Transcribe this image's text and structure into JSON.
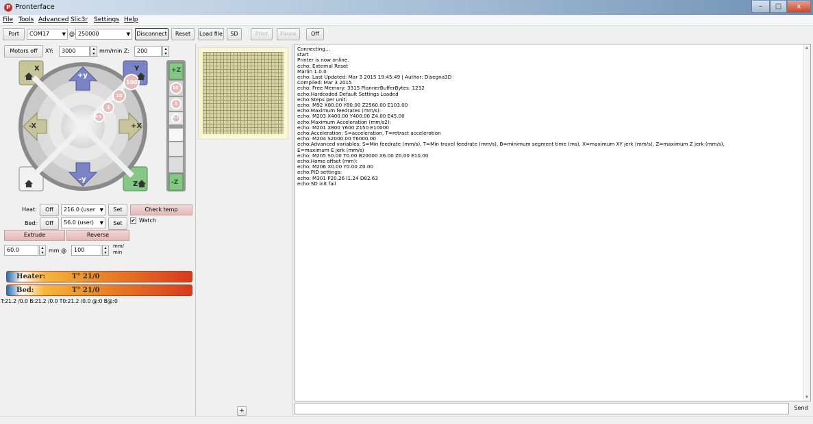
{
  "window": {
    "title": "Pronterface",
    "min_label": "–",
    "max_label": "□",
    "close_label": "x"
  },
  "menu": [
    {
      "label": "File"
    },
    {
      "label": "Tools"
    },
    {
      "label": "Advanced"
    },
    {
      "label": "Slic3r"
    },
    {
      "label": "Settings"
    },
    {
      "label": "Help"
    }
  ],
  "toolbar": {
    "port_label": "Port",
    "port_value": "COM17",
    "at": "@",
    "baud_value": "250000",
    "disconnect_label": "Disconnect",
    "reset_label": "Reset",
    "loadfile_label": "Load file",
    "sd_label": "SD",
    "print_label": "Print",
    "pause_label": "Pause",
    "off_label": "Off"
  },
  "motors": {
    "motors_off_label": "Motors off",
    "xy_label": "XY:",
    "xy_value": "3000",
    "unit_label": "mm/min Z:",
    "z_value": "200"
  },
  "jog": {
    "plus_y": "+y",
    "minus_y": "-y",
    "minus_x": "-X",
    "plus_x": "+X",
    "plus_z": "+Z",
    "minus_z": "-Z",
    "home_x": "X",
    "home_y": "Y",
    "home_z": "Z",
    "step_100": "100",
    "step_10": "10",
    "step_1": "1",
    "step_01": "0.1",
    "z_step_10": "10",
    "z_step_1": "1",
    "z_step_01": "0.1"
  },
  "temps": {
    "heat_label": "Heat:",
    "heat_off": "Off",
    "heat_value": "216.0 (user",
    "heat_set": "Set",
    "check_temp": "Check temp",
    "bed_label": "Bed:",
    "bed_off": "Off",
    "bed_value": "56.0 (user)",
    "bed_set": "Set",
    "watch_label": "Watch",
    "extrude_label": "Extrude",
    "reverse_label": "Reverse",
    "length_value": "60.0",
    "mm_at": "mm @",
    "speed_value": "100",
    "speed_unit_1": "mm/",
    "speed_unit_2": "min"
  },
  "gauges": {
    "heater_label": "Heater:",
    "heater_value": "T° 21/0",
    "bed_label": "Bed:",
    "bed_value": "T° 21/0",
    "status_line": "T:21.2 /0.0 B:21.2 /0.0 T0:21.2 /0.0 @:0 B@:0"
  },
  "preview": {
    "plus_label": "+"
  },
  "console": {
    "lines": [
      "Connecting...",
      "start",
      "Printer is now online.",
      "echo: External Reset",
      "Marlin 1.0.0",
      "echo: Last Updated: Mar  3 2015 19:45:49 | Author: Disegna3D",
      "Compiled: Mar  3 2015",
      "echo: Free Memory: 3315  PlannerBufferBytes: 1232",
      "echo:Hardcoded Default Settings Loaded",
      "echo:Steps per unit:",
      "echo:  M92 X80.00 Y80.00 Z2560.00 E103.00",
      "echo:Maximum feedrates (mm/s):",
      "echo:  M203 X400.00 Y400.00 Z4.00 E45.00",
      "echo:Maximum Acceleration (mm/s2):",
      "echo:  M201 X800 Y600 Z150 E10000",
      "echo:Acceleration: S=acceleration, T=retract acceleration",
      "echo:  M204 S2000.00 T6000.00",
      "echo:Advanced variables: S=Min feedrate (mm/s), T=Min travel feedrate (mm/s), B=minimum segment time (ms), X=maximum XY jerk (mm/s),  Z=maximum Z jerk (mm/s),",
      "E=maximum E jerk (mm/s)",
      "echo:  M205 S0.00 T0.00 B20000 X6.00 Z0.00 E10.00",
      "echo:Home offset (mm):",
      "echo:  M206 X0.00 Y0.00 Z0.00",
      "echo:PID settings:",
      "echo:   M301 P20.26 I1.24 D82.63",
      "echo:SD init fail"
    ],
    "send_label": "Send",
    "input_value": ""
  }
}
